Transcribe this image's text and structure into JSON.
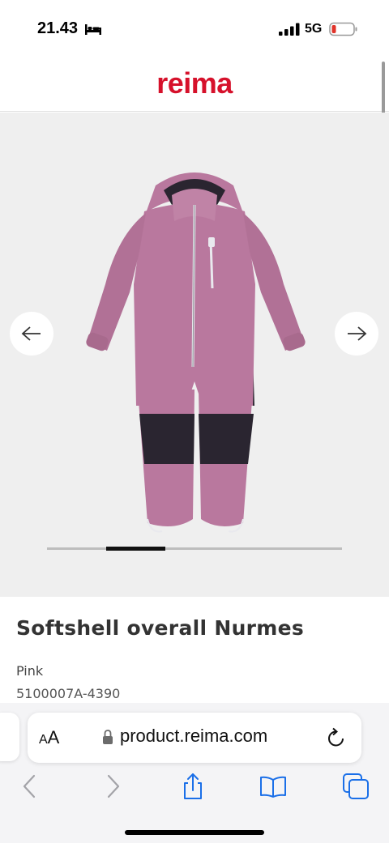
{
  "status_bar": {
    "time": "21.43",
    "network": "5G",
    "icons": [
      "bed-icon",
      "signal-icon",
      "battery-icon"
    ],
    "battery_color": "#e0332a"
  },
  "header": {
    "logo_text": "reima",
    "brand_color": "#d6112b"
  },
  "gallery": {
    "image_alt": "pink softshell overall",
    "prev_icon": "arrow-left-icon",
    "next_icon": "arrow-right-icon",
    "progress_fraction_start": 0.2,
    "progress_fraction_end": 0.4,
    "product_colors": {
      "main": "#b9789e",
      "patches": "#2a2530"
    }
  },
  "product": {
    "title": "Softshell overall Nurmes",
    "color": "Pink",
    "code": "5100007A-4390"
  },
  "browser": {
    "text_size_label_small": "A",
    "text_size_label_large": "A",
    "url": "product.reima.com",
    "accent_color": "#1a6fe8",
    "toolbar_icons": [
      "back-icon",
      "forward-icon",
      "share-icon",
      "bookmarks-icon",
      "tabs-icon"
    ]
  }
}
